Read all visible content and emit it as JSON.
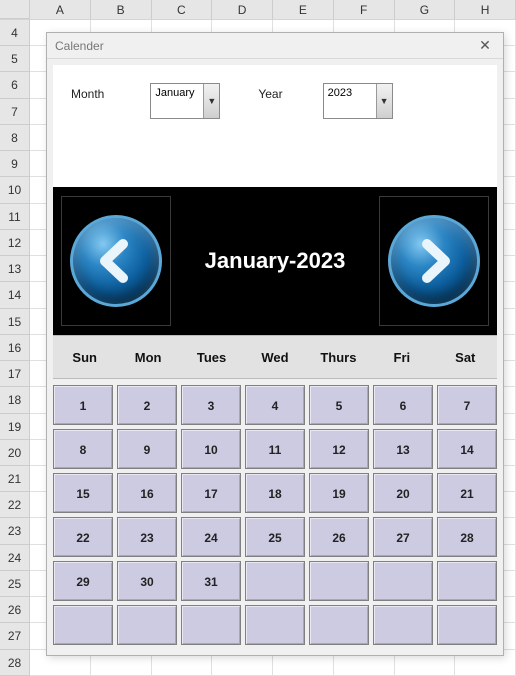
{
  "sheet": {
    "columns": [
      "A",
      "B",
      "C",
      "D",
      "E",
      "F",
      "G",
      "H"
    ],
    "row_start": 4,
    "row_end": 28
  },
  "dialog": {
    "title": "Calender",
    "close": "✕",
    "controls": {
      "month_label": "Month",
      "month_value": "January",
      "year_label": "Year",
      "year_value": "2023"
    },
    "banner_title": "January-2023",
    "dow": [
      "Sun",
      "Mon",
      "Tues",
      "Wed",
      "Thurs",
      "Fri",
      "Sat"
    ],
    "days": [
      "1",
      "2",
      "3",
      "4",
      "5",
      "6",
      "7",
      "8",
      "9",
      "10",
      "11",
      "12",
      "13",
      "14",
      "15",
      "16",
      "17",
      "18",
      "19",
      "20",
      "21",
      "22",
      "23",
      "24",
      "25",
      "26",
      "27",
      "28",
      "29",
      "30",
      "31",
      "",
      "",
      "",
      "",
      "",
      "",
      "",
      "",
      "",
      "",
      ""
    ]
  }
}
